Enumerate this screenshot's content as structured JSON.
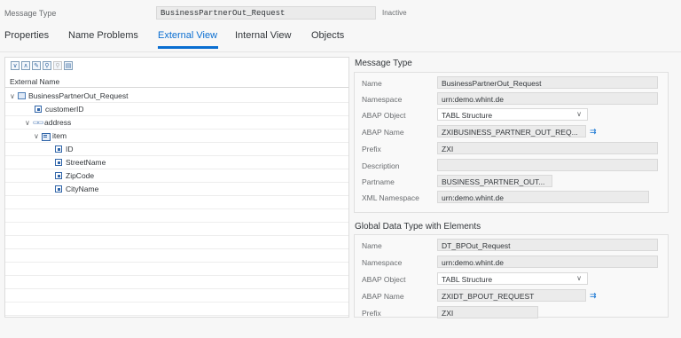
{
  "header": {
    "label": "Message Type",
    "value": "BusinessPartnerOut_Request",
    "status": "Inactive"
  },
  "tabs": [
    {
      "label": "Properties"
    },
    {
      "label": "Name Problems"
    },
    {
      "label": "External View"
    },
    {
      "label": "Internal View"
    },
    {
      "label": "Objects"
    }
  ],
  "active_tab": "External View",
  "tree": {
    "column_header": "External Name",
    "toolbar_icons": [
      "expand-all-icon",
      "collapse-all-icon",
      "edit-icon",
      "find-icon",
      "find-next-icon",
      "details-icon"
    ],
    "nodes": [
      {
        "label": "BusinessPartnerOut_Request",
        "icon": "message-structure-icon"
      },
      {
        "label": "customerID",
        "icon": "element-icon"
      },
      {
        "label": "address",
        "icon": "complex-type-icon"
      },
      {
        "label": "item",
        "icon": "folder-icon"
      },
      {
        "label": "ID",
        "icon": "element-icon"
      },
      {
        "label": "StreetName",
        "icon": "element-icon"
      },
      {
        "label": "ZipCode",
        "icon": "element-icon"
      },
      {
        "label": "CityName",
        "icon": "element-icon"
      }
    ]
  },
  "message_type": {
    "title": "Message Type",
    "fields": {
      "name": {
        "label": "Name",
        "value": "BusinessPartnerOut_Request"
      },
      "namespace": {
        "label": "Namespace",
        "value": "urn:demo.whint.de"
      },
      "abap_object": {
        "label": "ABAP Object",
        "value": "TABL Structure"
      },
      "abap_name": {
        "label": "ABAP Name",
        "value": "ZXIBUSINESS_PARTNER_OUT_REQ..."
      },
      "prefix": {
        "label": "Prefix",
        "value": "ZXI"
      },
      "description": {
        "label": "Description",
        "value": ""
      },
      "partname": {
        "label": "Partname",
        "value": "BUSINESS_PARTNER_OUT..."
      },
      "xml_namespace": {
        "label": "XML Namespace",
        "value": "urn:demo.whint.de"
      }
    }
  },
  "global_data_type": {
    "title": "Global Data Type with Elements",
    "fields": {
      "name": {
        "label": "Name",
        "value": "DT_BPOut_Request"
      },
      "namespace": {
        "label": "Namespace",
        "value": "urn:demo.whint.de"
      },
      "abap_object": {
        "label": "ABAP Object",
        "value": "TABL Structure"
      },
      "abap_name": {
        "label": "ABAP Name",
        "value": "ZXIDT_BPOUT_REQUEST"
      },
      "prefix": {
        "label": "Prefix",
        "value": "ZXI"
      }
    }
  },
  "colors": {
    "accent": "#0a6ed1",
    "field_bg": "#ebebeb"
  }
}
